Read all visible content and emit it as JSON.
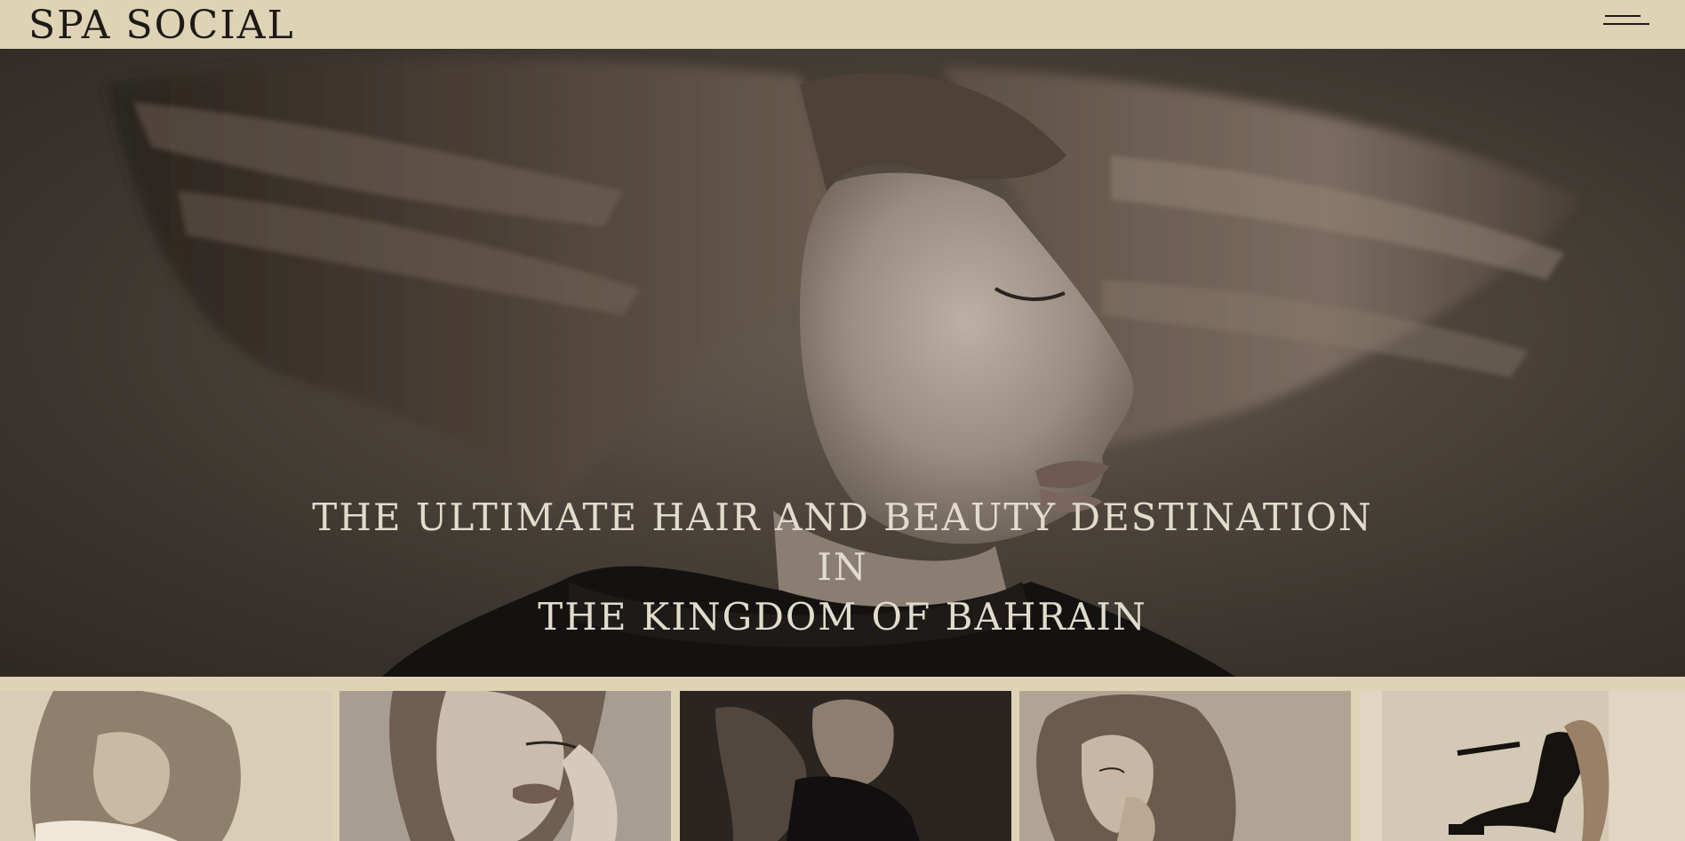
{
  "header": {
    "brand": "SPA SOCIAL",
    "menu_icon": "hamburger-menu-icon"
  },
  "hero": {
    "title_line_1": "THE ULTIMATE HAIR AND BEAUTY DESTINATION IN",
    "title_line_2": "THE KINGDOM OF BAHRAIN",
    "image": "woman with motion-blurred flying bob haircut, eyes closed, black turtleneck"
  },
  "gallery": {
    "items": [
      {
        "image": "woman with long wavy hair, head tilted, light background"
      },
      {
        "image": "woman with hand near face, dramatic makeup"
      },
      {
        "image": "woman with flying hair on dark background"
      },
      {
        "image": "woman with voluminous hair, hand at chin"
      },
      {
        "image": "woman in black outfit seated on floor, long hair"
      }
    ]
  },
  "colors": {
    "background": "#ded3b5",
    "text_dark": "#1d1a16",
    "hero_text": "#e2dccd"
  }
}
